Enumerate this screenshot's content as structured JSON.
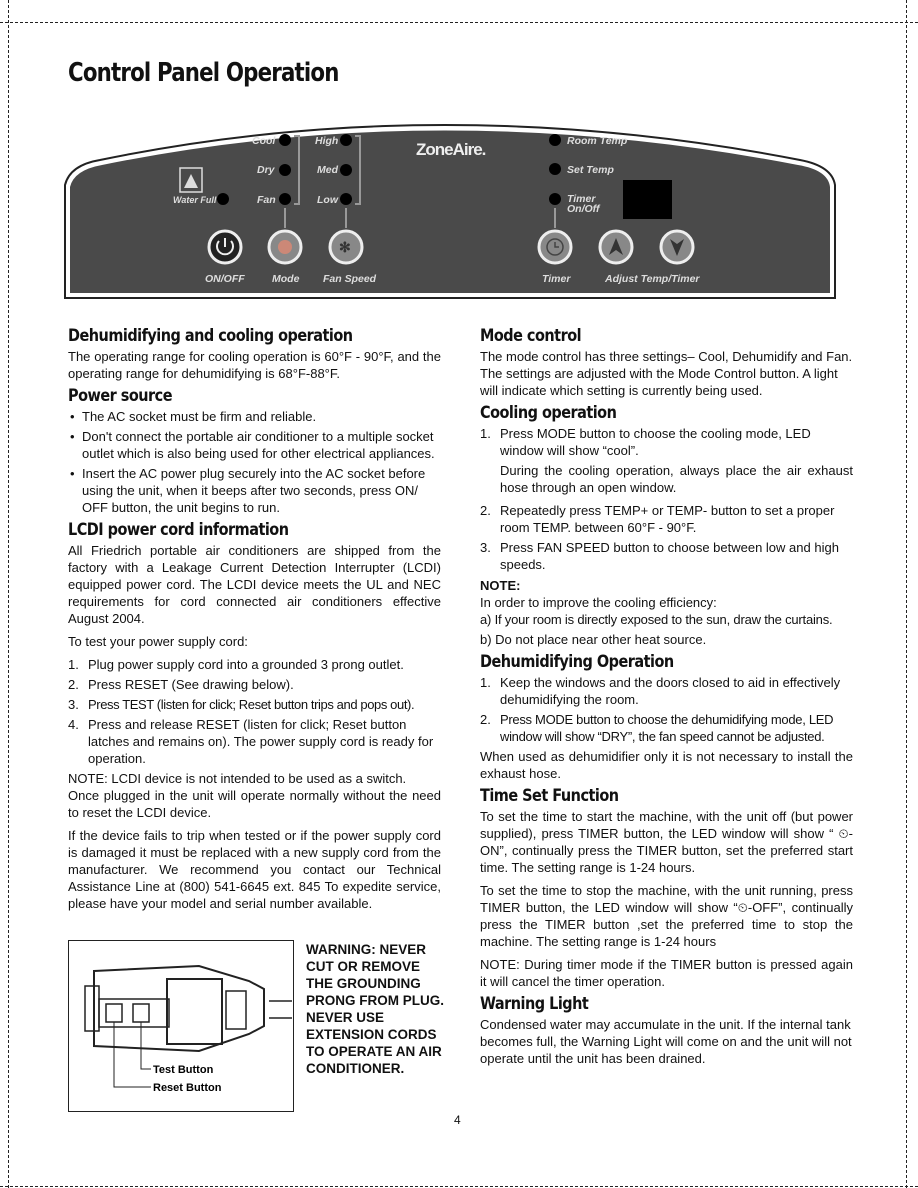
{
  "title": "Control Panel Operation",
  "panel": {
    "brand": "ZoneAire.",
    "water_full": "Water Full",
    "modes": [
      "Cool",
      "Dry",
      "Fan"
    ],
    "speeds": [
      "High",
      "Med",
      "Low"
    ],
    "indicators": [
      "Room Temp",
      "Set Temp",
      "Timer",
      "On/Off"
    ],
    "buttons": [
      "ON/OFF",
      "Mode",
      "Fan Speed",
      "Timer",
      "Adjust Temp/Timer"
    ],
    "panel_color": "#4a4a4a"
  },
  "left": {
    "s1": {
      "h": "Dehumidifying and cooling operation",
      "p": "The operating range for cooling operation is 60°F - 90°F, and the operating range for dehumidifying is 68°F-88°F."
    },
    "s2": {
      "h": "Power source",
      "items": [
        "The AC socket must be firm and reliable.",
        "Don't connect the portable air conditioner to a multiple socket outlet which is also being used for other electrical appliances.",
        "Insert the AC power plug securely into the AC socket before using the unit, when it beeps after two seconds, press ON/ OFF button, the unit begins to run."
      ]
    },
    "s3": {
      "h": "LCDI power cord information",
      "p1": "All Friedrich portable air conditioners are shipped from the factory with a Leakage Current Detection Interrupter (LCDI) equipped power cord. The LCDI device meets the UL and NEC requirements for cord connected air conditioners effective August 2004.",
      "p2": "To test your power supply cord:",
      "steps": [
        {
          "n": "1.",
          "t": "Plug power supply cord into a grounded 3 prong outlet."
        },
        {
          "n": "2.",
          "t": "Press RESET (See drawing below)."
        },
        {
          "n": "3.",
          "t": "Press TEST (listen for click; Reset button trips and pops out)."
        },
        {
          "n": "4.",
          "t": "Press and release RESET (listen for click; Reset button latches and remains on). The power supply cord is ready for operation."
        }
      ],
      "p3": "NOTE: LCDI device is not intended to be used as a switch.",
      "p4": "Once plugged in the unit will operate normally without the need to reset the LCDI device.",
      "p5": "If the device fails to trip when tested or if the power supply cord is damaged it must be replaced with a new supply cord from the manufacturer. We recommend you contact our Technical Assistance Line at (800) 541-6645 ext. 845 To expedite service, please have your model and serial number available."
    }
  },
  "figure": {
    "test": "Test Button",
    "reset": "Reset Button",
    "warning": "WARNING: NEVER CUT OR REMOVE THE GROUNDING PRONG FROM PLUG. NEVER USE EXTENSION CORDS TO OPERATE AN AIR CONDITIONER."
  },
  "right": {
    "s1": {
      "h": "Mode control",
      "p": "The mode control has three settings– Cool, Dehumidify and Fan. The settings are adjusted with the Mode Control button. A light will indicate which setting is currently being used."
    },
    "s2": {
      "h": "Cooling operation",
      "steps": [
        {
          "n": "1.",
          "t": "Press MODE button to choose the cooling mode, LED window will show “cool”."
        },
        {
          "n": "2.",
          "t": "Repeatedly press TEMP+ or TEMP- button to set a proper room TEMP. between 60°F - 90°F."
        },
        {
          "n": "3.",
          "t": "Press FAN SPEED button to choose between low and high speeds."
        }
      ],
      "sub": "During the cooling operation, always place the air exhaust hose through an open window.",
      "note": "NOTE:",
      "note_p": "In order to improve the cooling efficiency:",
      "a": "a) If your room is directly exposed to the sun, draw the curtains.",
      "b": "b)  Do not place near other heat source."
    },
    "s3": {
      "h": "Dehumidifying Operation",
      "steps": [
        {
          "n": "1.",
          "t": "Keep the windows and the doors closed to aid in effectively dehumidifying the room."
        },
        {
          "n": "2.",
          "t": "Press MODE button to choose the dehumidifying mode, LED window will show  “DRY”, the fan speed cannot be adjusted."
        }
      ],
      "p": "When used as dehumidifier only it is not necessary to install the exhaust hose."
    },
    "s4": {
      "h": "Time Set Function",
      "p1": "To set the time to start the machine, with the unit off (but power supplied), press TIMER button, the LED window will show “ ⏲-ON”, continually press the TIMER button, set the preferred start time.  The setting range is 1-24 hours.",
      "p2": "To set the time to stop the machine, with the unit running, press TIMER button, the LED window will show “⏲-OFF”, continually press the TIMER button ,set the preferred time to stop the machine.  The setting range is 1-24 hours",
      "p3": "NOTE: During timer mode if the TIMER button is pressed again it will cancel the timer operation."
    },
    "s5": {
      "h": "Warning Light",
      "p": "Condensed water may accumulate in the unit. If the internal tank becomes full, the Warning Light will come on and the unit will not operate until the unit has been drained."
    }
  },
  "page_number": "4"
}
